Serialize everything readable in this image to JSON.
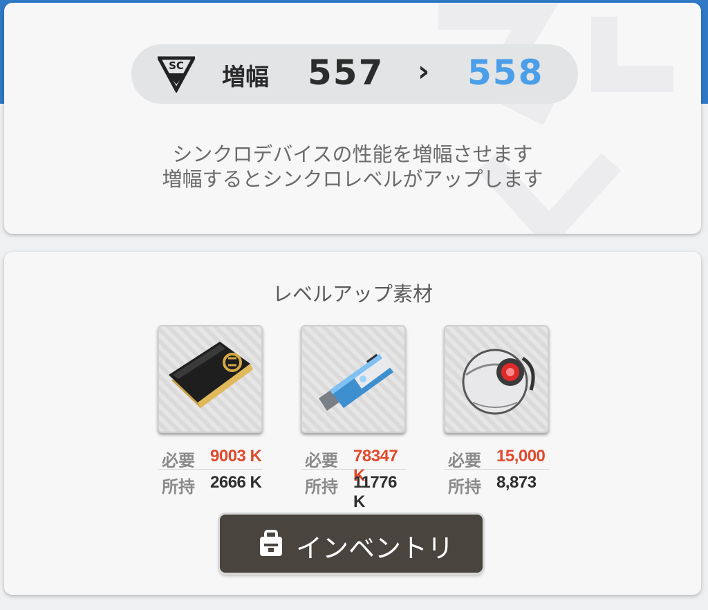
{
  "amplify": {
    "label": "増幅",
    "current_level": "557",
    "arrow": "›",
    "next_level": "558"
  },
  "description": {
    "line1": "シンクロデバイスの性能を増幅させます",
    "line2": "増幅するとシンクロレベルがアップします"
  },
  "materials": {
    "title": "レベルアップ素材",
    "items": [
      {
        "icon": "credit-card-icon",
        "required_label": "必要",
        "required": "9003 K",
        "owned_label": "所持",
        "owned": "2666 K"
      },
      {
        "icon": "usb-drive-icon",
        "required_label": "必要",
        "required": "78347 K",
        "owned_label": "所持",
        "owned": "11776 K"
      },
      {
        "icon": "robot-sphere-icon",
        "required_label": "必要",
        "required": "15,000",
        "owned_label": "所持",
        "owned": "8,873"
      }
    ]
  },
  "inventory_button": {
    "label": "インベントリ"
  },
  "colors": {
    "next_level": "#4a9fe8",
    "required_value": "#e04a2c",
    "button_bg": "#4a443f",
    "top_stripe": "#2f79c7"
  }
}
